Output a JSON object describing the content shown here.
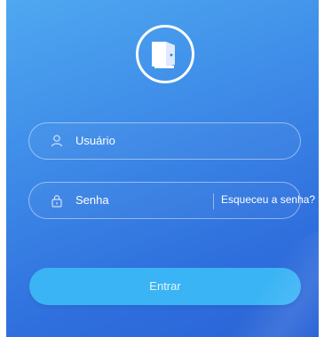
{
  "login": {
    "logo_icon": "door-icon",
    "username_placeholder": "Usuário",
    "password_placeholder": "Senha",
    "forgot_password": "Esqueceu a senha?",
    "submit_label": "Entrar"
  },
  "colors": {
    "gradient_start": "#4fa8f0",
    "gradient_end": "#2a63d6",
    "button": "#3ab4f5"
  }
}
